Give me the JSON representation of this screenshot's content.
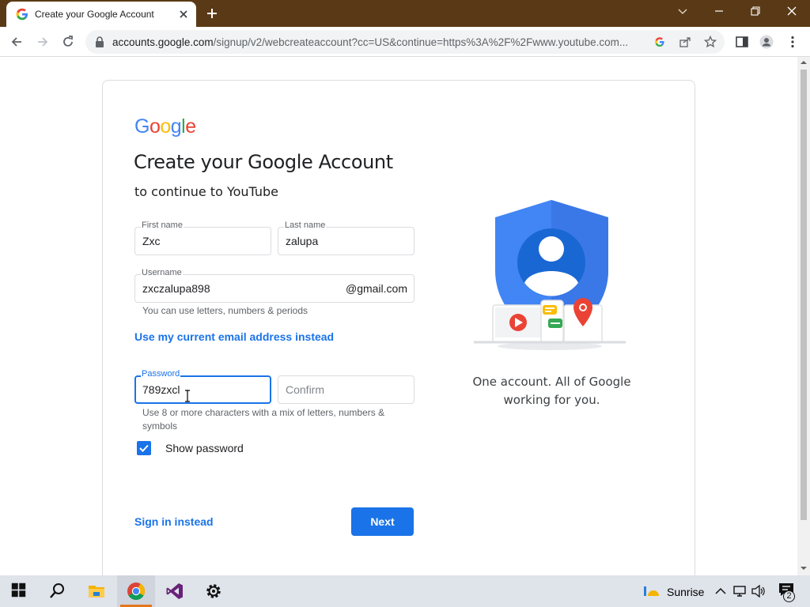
{
  "browser": {
    "tab_title": "Create your Google Account",
    "url_host": "accounts.google.com",
    "url_path": "/signup/v2/webcreateaccount?cc=US&continue=https%3A%2F%2Fwww.youtube.com..."
  },
  "page": {
    "logo_text": [
      "G",
      "o",
      "o",
      "g",
      "l",
      "e"
    ],
    "logo_colors": [
      "#4285f4",
      "#ea4335",
      "#fbbc05",
      "#4285f4",
      "#34a853",
      "#ea4335"
    ],
    "heading": "Create your Google Account",
    "subheading": "to continue to YouTube",
    "first_name": {
      "label": "First name",
      "value": "Zxc"
    },
    "last_name": {
      "label": "Last name",
      "value": "zalupa"
    },
    "username": {
      "label": "Username",
      "value": "zxczalupa898",
      "suffix": "@gmail.com",
      "hint": "You can use letters, numbers & periods"
    },
    "use_current_email_link": "Use my current email address instead",
    "password": {
      "label": "Password",
      "value": "789zxcl"
    },
    "confirm": {
      "placeholder": "Confirm"
    },
    "password_hint": "Use 8 or more characters with a mix of letters, numbers & symbols",
    "show_password": {
      "label": "Show password",
      "checked": true
    },
    "sign_in_link": "Sign in instead",
    "next_button": "Next",
    "tagline": "One account. All of Google working for you."
  },
  "taskbar": {
    "weather": "Sunrise",
    "notification_count": "2"
  },
  "colors": {
    "accent": "#1a73e8",
    "tab_strip": "#5a3a16"
  }
}
